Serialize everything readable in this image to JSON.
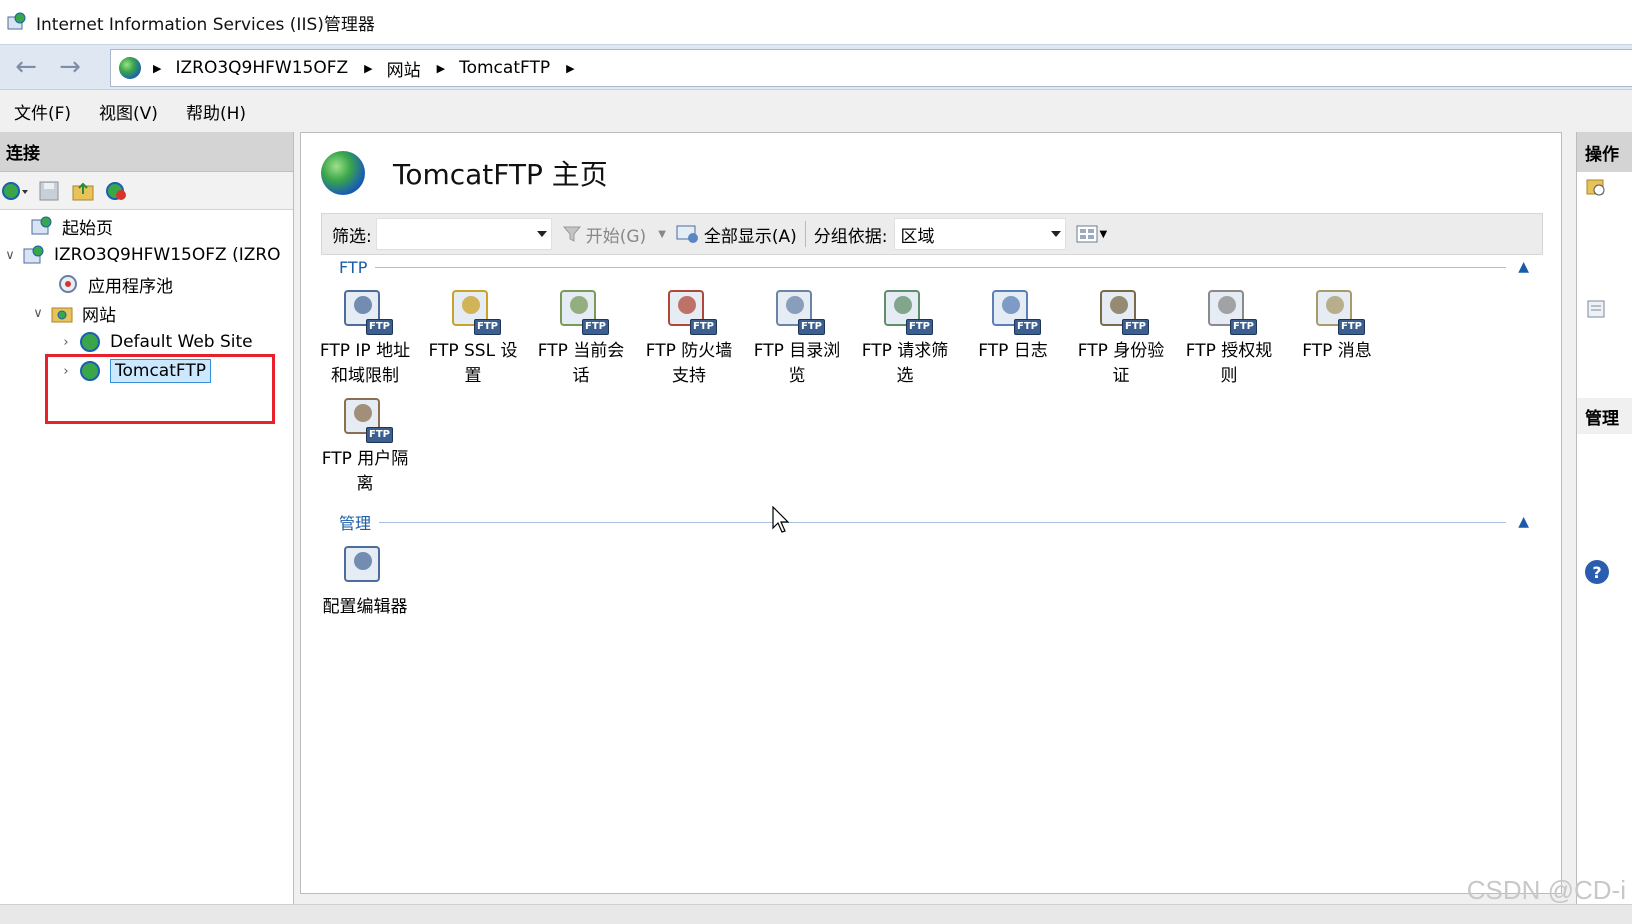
{
  "window": {
    "title": "Internet Information Services (IIS)管理器"
  },
  "address": {
    "crumbs": [
      "IZRO3Q9HFW15OFZ",
      "网站",
      "TomcatFTP"
    ]
  },
  "menu": {
    "file": "文件(F)",
    "view": "视图(V)",
    "help": "帮助(H)"
  },
  "connections": {
    "header": "连接",
    "tree": {
      "start_page": "起始页",
      "server": "IZRO3Q9HFW15OFZ (IZRO",
      "app_pools": "应用程序池",
      "sites": "网站",
      "default_site": "Default Web Site",
      "tomcat_ftp": "TomcatFTP"
    }
  },
  "main": {
    "title": "TomcatFTP 主页",
    "filter": {
      "label": "筛选:",
      "go_label": "开始(G)",
      "show_all_label": "全部显示(A)",
      "group_by_label": "分组依据:",
      "group_by_value": "区域"
    },
    "sections": {
      "ftp": "FTP",
      "manage": "管理"
    },
    "ftp_features": [
      {
        "line1": "FTP IP 地址",
        "line2": "和域限制"
      },
      {
        "line1": "FTP SSL 设",
        "line2": "置"
      },
      {
        "line1": "FTP 当前会",
        "line2": "话"
      },
      {
        "line1": "FTP 防火墙",
        "line2": "支持"
      },
      {
        "line1": "FTP 目录浏",
        "line2": "览"
      },
      {
        "line1": "FTP 请求筛",
        "line2": "选"
      },
      {
        "line1": "FTP 日志",
        "line2": ""
      },
      {
        "line1": "FTP 身份验",
        "line2": "证"
      },
      {
        "line1": "FTP 授权规",
        "line2": "则"
      },
      {
        "line1": "FTP 消息",
        "line2": ""
      },
      {
        "line1": "FTP 用户隔",
        "line2": "离"
      }
    ],
    "manage_features": [
      {
        "line1": "配置编辑器",
        "line2": ""
      }
    ],
    "ftp_badge": "FTP"
  },
  "actions": {
    "header": "操作",
    "manage_header": "管理"
  },
  "watermark": "CSDN @CD-i",
  "colors": {
    "selection_border": "#e8202a",
    "section_blue": "#1a5ca8",
    "selected_item": "#cce8ff"
  }
}
